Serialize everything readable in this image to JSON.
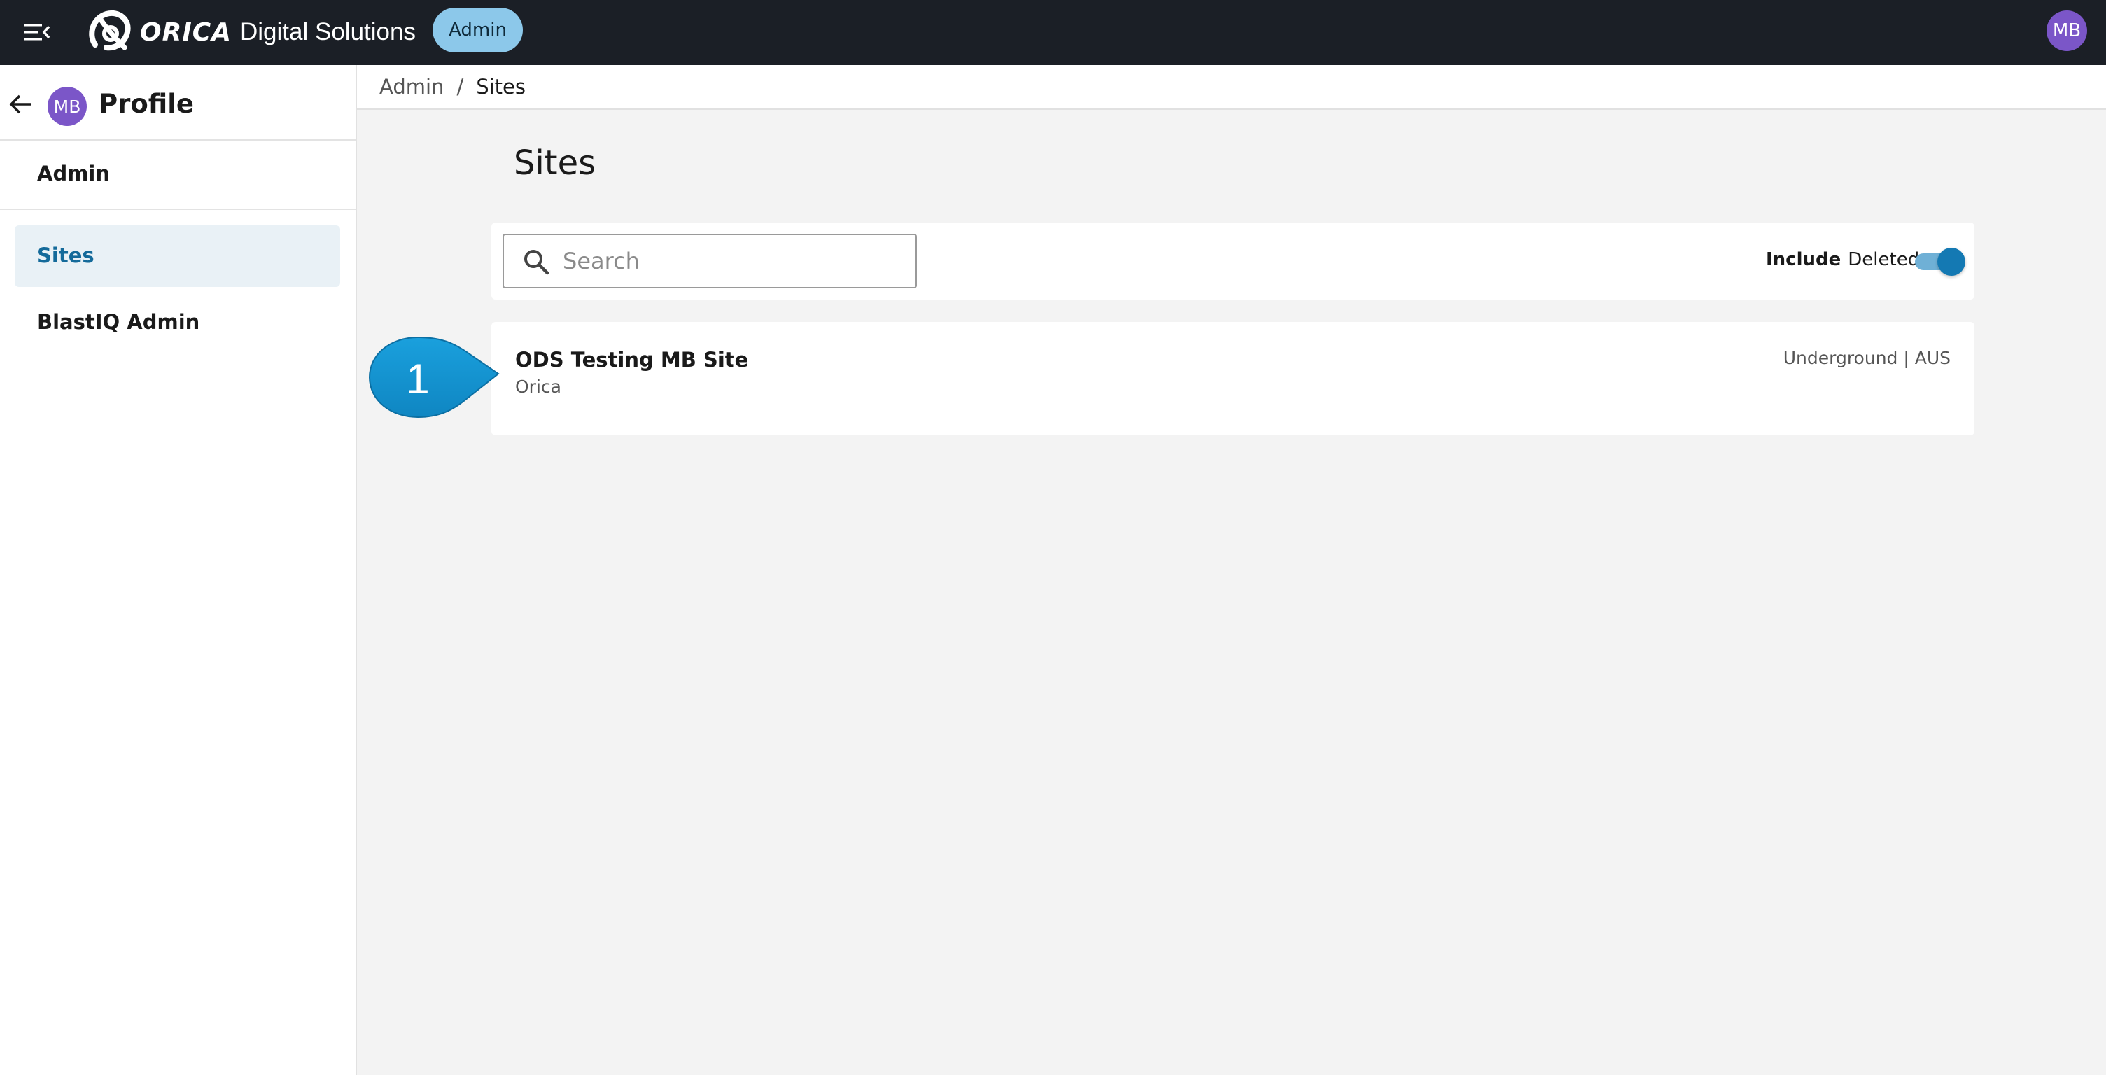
{
  "topbar": {
    "brand_name": "ORICA",
    "brand_suffix": "Digital Solutions",
    "admin_chip": "Admin",
    "user_initials": "MB",
    "menu_icon": "menu-collapse-icon"
  },
  "sidebar": {
    "profile_initials": "MB",
    "profile_title": "Profile",
    "section_label": "Admin",
    "items": [
      {
        "label": "Sites",
        "active": true
      },
      {
        "label": "BlastIQ Admin",
        "active": false
      }
    ]
  },
  "breadcrumb": {
    "parent": "Admin",
    "separator": "/",
    "current": "Sites"
  },
  "main": {
    "title": "Sites",
    "search": {
      "placeholder": "Search",
      "value": ""
    },
    "include_deleted": {
      "bold": "Include",
      "label": "Deleted",
      "enabled": true
    },
    "sites": [
      {
        "name": "ODS Testing MB Site",
        "organization": "Orica",
        "meta": "Underground | AUS"
      }
    ]
  },
  "callout": {
    "number": "1",
    "color": "#1592cf"
  },
  "colors": {
    "topbar": "#1b1f26",
    "admin_chip": "#8cc8ea",
    "avatar": "#7b56c8",
    "active_nav_bg": "#e9f1f6",
    "active_nav_text": "#146a9a",
    "toggle": "#1479b3"
  }
}
